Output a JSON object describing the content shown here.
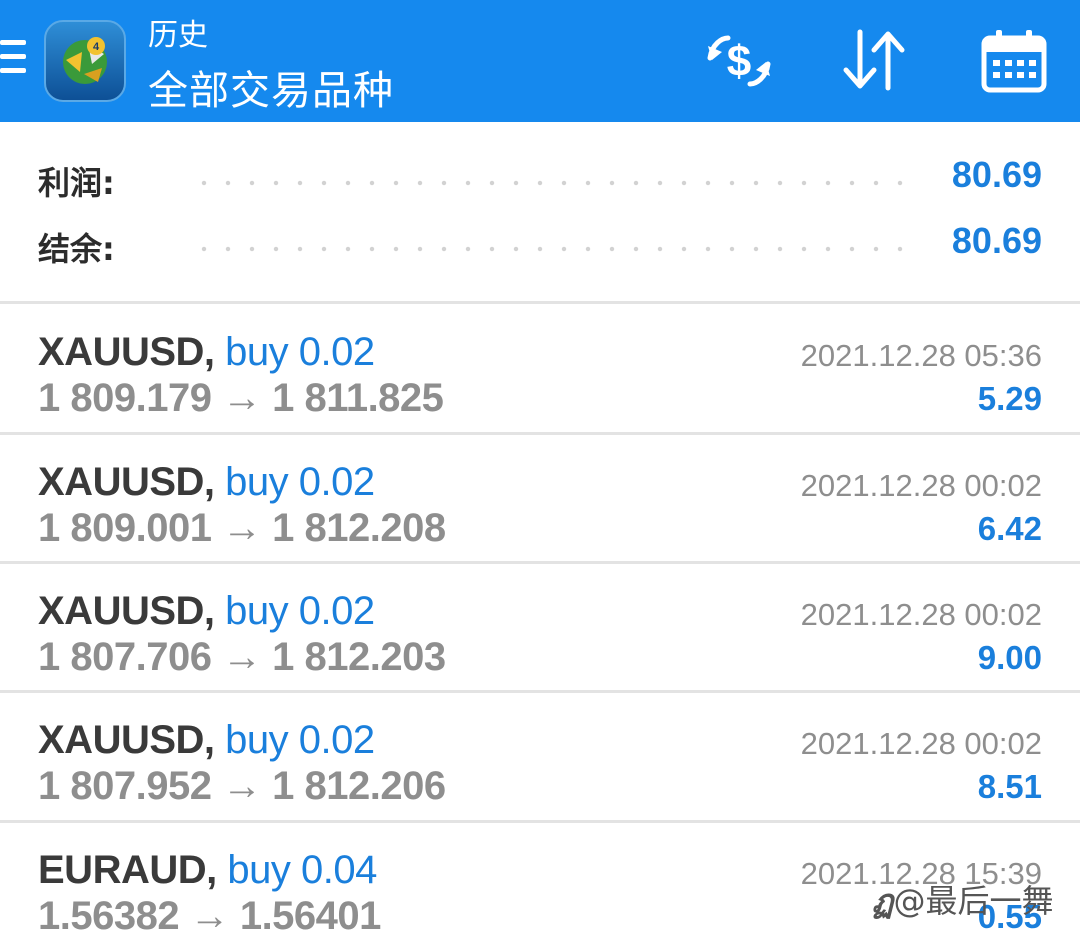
{
  "header": {
    "subtitle": "历史",
    "title": "全部交易品种",
    "icons": [
      "menu-icon",
      "app-logo",
      "money-exchange-icon",
      "sort-icon",
      "calendar-icon"
    ],
    "accent_color": "#1589ee"
  },
  "summary": {
    "profit_label": "利润:",
    "profit_value": "80.69",
    "balance_label": "结余:",
    "balance_value": "80.69"
  },
  "trades": [
    {
      "symbol": "XAUUSD",
      "comma": ",",
      "direction": "buy 0.02",
      "prices": "1 809.179 → 1 811.825",
      "time": "2021.12.28 05:36",
      "profit": "5.29"
    },
    {
      "symbol": "XAUUSD",
      "comma": ",",
      "direction": "buy 0.02",
      "prices": "1 809.001 → 1 812.208",
      "time": "2021.12.28 00:02",
      "profit": "6.42"
    },
    {
      "symbol": "XAUUSD",
      "comma": ",",
      "direction": "buy 0.02",
      "prices": "1 807.706 → 1 812.203",
      "time": "2021.12.28 00:02",
      "profit": "9.00"
    },
    {
      "symbol": "XAUUSD",
      "comma": ",",
      "direction": "buy 0.02",
      "prices": "1 807.952 → 1 812.206",
      "time": "2021.12.28 00:02",
      "profit": "8.51"
    },
    {
      "symbol": "EURAUD",
      "comma": ",",
      "direction": "buy 0.04",
      "prices": "1.56382 → 1.56401",
      "time": "2021.12.28 15:39",
      "profit": "0.55"
    }
  ],
  "watermark": {
    "icon_text": "ฏ",
    "text": "@最后一舞"
  }
}
